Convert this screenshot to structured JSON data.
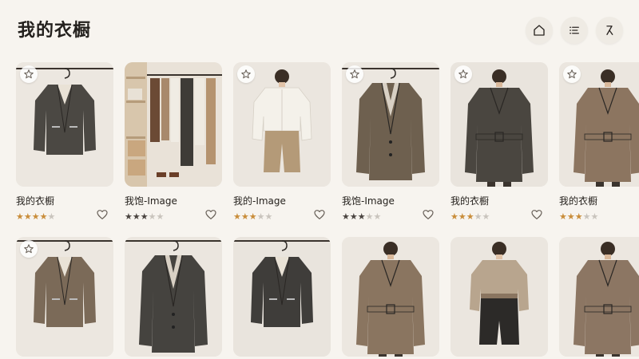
{
  "header": {
    "title": "我的衣橱",
    "actions": [
      {
        "icon": "home-icon"
      },
      {
        "icon": "filter-list-icon"
      },
      {
        "icon": "hanger-icon"
      }
    ]
  },
  "colors": {
    "background": "#f7f4ef",
    "star_gold": "#c98d3a",
    "star_dark": "#4a4440",
    "star_empty": "#c9c4bd"
  },
  "items": [
    {
      "name": "我的衣橱",
      "rating": 4,
      "star_color": "gold",
      "garment": "jacket",
      "color": "#4b4843",
      "bg": "#ece7e0",
      "favorite_icon": true
    },
    {
      "name": "我饱-Image",
      "rating": 3,
      "star_color": "dark",
      "garment": "closet",
      "color": "#5a5046",
      "bg": "#e9e2d8",
      "favorite_icon": false
    },
    {
      "name": "我的-Image",
      "rating": 3,
      "star_color": "gold",
      "garment": "blouse",
      "color": "#b49a78",
      "bg": "#ebe6df",
      "favorite_icon": true
    },
    {
      "name": "我饱-Image",
      "rating": 3,
      "star_color": "dark",
      "garment": "coat",
      "color": "#6e604f",
      "bg": "#ece7e0",
      "favorite_icon": true
    },
    {
      "name": "我的衣橱",
      "rating": 3,
      "star_color": "gold",
      "garment": "trench",
      "color": "#4a4640",
      "bg": "#e9e4dd",
      "favorite_icon": true
    },
    {
      "name": "我的衣橱",
      "rating": 3,
      "star_color": "gold",
      "garment": "trench",
      "color": "#8c7560",
      "bg": "#ebe6df",
      "favorite_icon": true
    },
    {
      "name": "",
      "rating": 0,
      "star_color": "gold",
      "garment": "jacket",
      "color": "#7b6a58",
      "bg": "#ece7e0",
      "favorite_icon": true
    },
    {
      "name": "",
      "rating": 0,
      "star_color": "gold",
      "garment": "coat",
      "color": "#45433f",
      "bg": "#ebe6df",
      "favorite_icon": false
    },
    {
      "name": "",
      "rating": 0,
      "star_color": "gold",
      "garment": "jacket",
      "color": "#3f3d3a",
      "bg": "#e9e4dd",
      "favorite_icon": false
    },
    {
      "name": "",
      "rating": 0,
      "star_color": "gold",
      "garment": "trench",
      "color": "#8a7560",
      "bg": "#ece7e0",
      "favorite_icon": false
    },
    {
      "name": "",
      "rating": 0,
      "star_color": "gold",
      "garment": "blouse-skirt",
      "color": "#b8a58e",
      "bg": "#ebe6df",
      "favorite_icon": false
    },
    {
      "name": "",
      "rating": 0,
      "star_color": "gold",
      "garment": "trench",
      "color": "#8c7663",
      "bg": "#ece7e0",
      "favorite_icon": false
    }
  ]
}
